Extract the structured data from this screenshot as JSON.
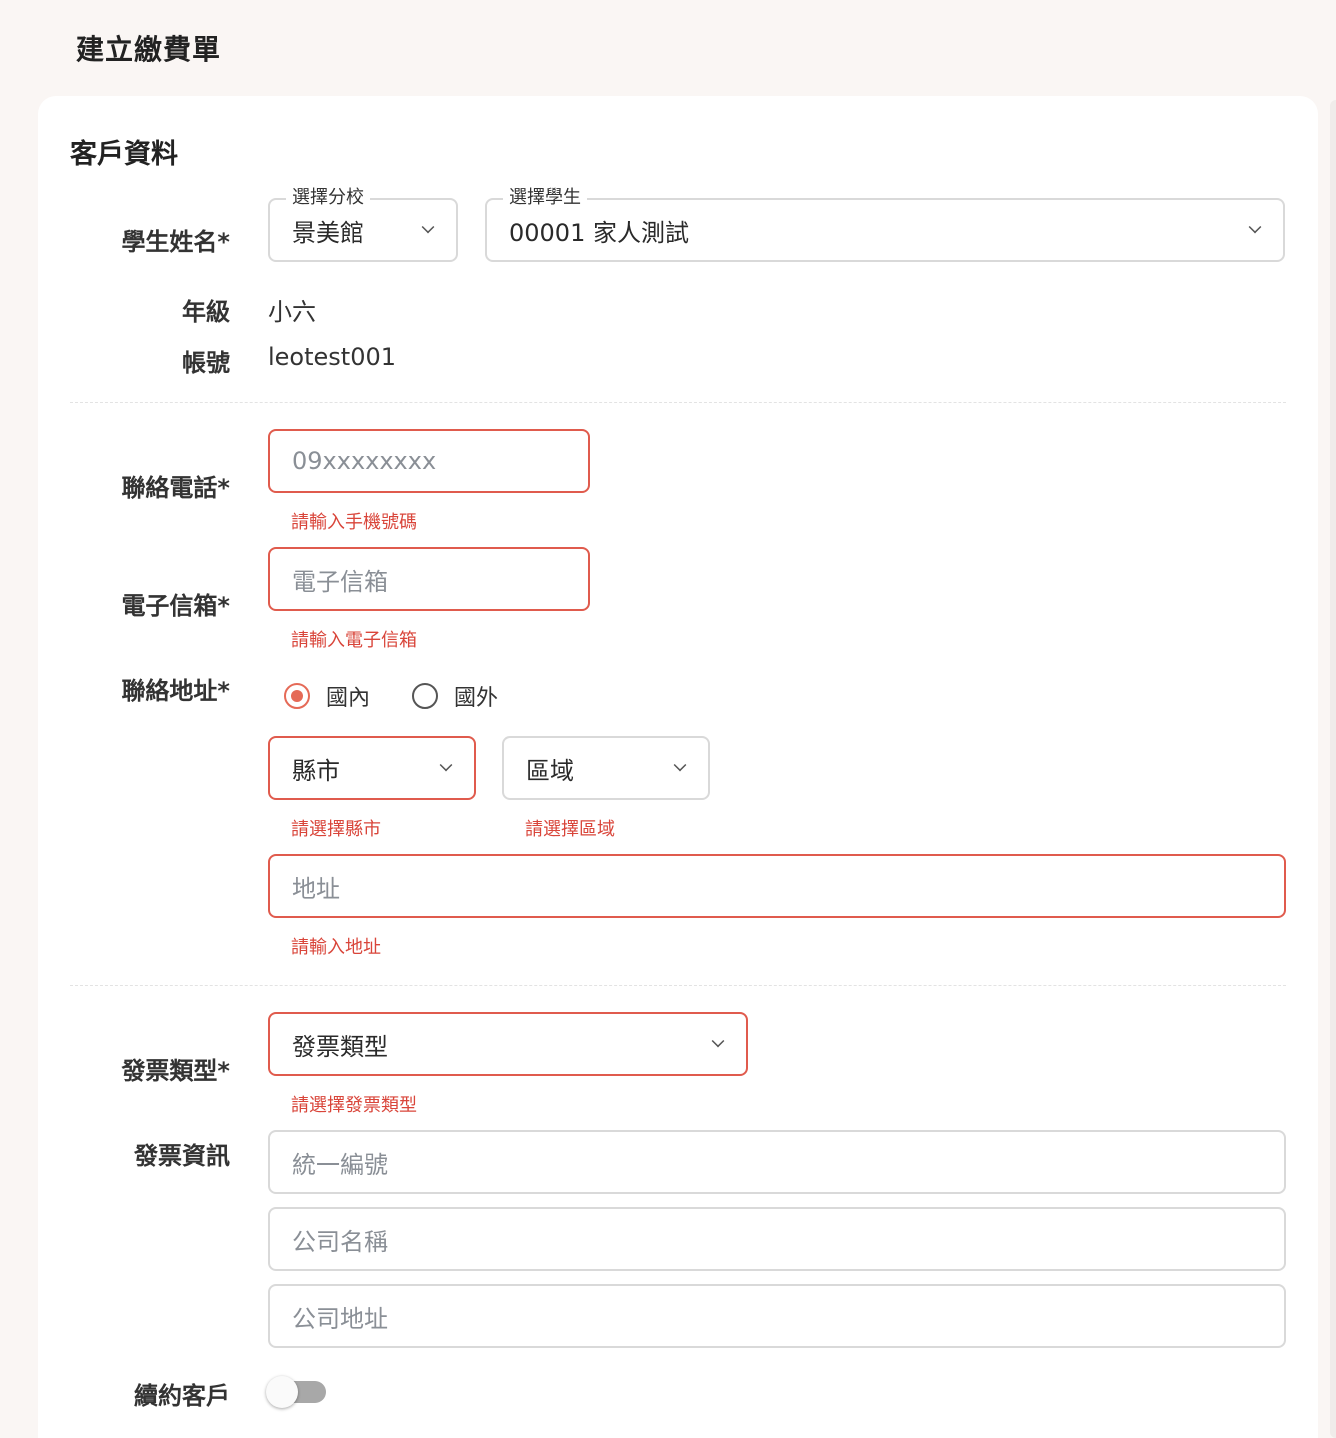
{
  "page": {
    "title": "建立繳費單"
  },
  "section": {
    "title": "客戶資料"
  },
  "student": {
    "label": "學生姓名*",
    "school_legend": "選擇分校",
    "school_value": "景美館",
    "student_legend": "選擇學生",
    "student_value": "00001 家人測試",
    "grade_label": "年級",
    "grade_value": "小六",
    "account_label": "帳號",
    "account_value": "leotest001"
  },
  "phone": {
    "label": "聯絡電話*",
    "placeholder": "09xxxxxxxx",
    "error": "請輸入手機號碼"
  },
  "email": {
    "label": "電子信箱*",
    "placeholder": "電子信箱",
    "error": "請輸入電子信箱"
  },
  "address": {
    "label": "聯絡地址*",
    "radio_domestic": "國內",
    "radio_foreign": "國外",
    "selected": "國內",
    "city_placeholder": "縣市",
    "city_error": "請選擇縣市",
    "district_placeholder": "區域",
    "district_error": "請選擇區域",
    "street_placeholder": "地址",
    "street_error": "請輸入地址"
  },
  "invoice": {
    "type_label": "發票類型*",
    "type_placeholder": "發票類型",
    "type_error": "請選擇發票類型",
    "info_label": "發票資訊",
    "tax_id_placeholder": "統一編號",
    "company_name_placeholder": "公司名稱",
    "company_address_placeholder": "公司地址"
  },
  "renewal": {
    "label": "續約客戶",
    "enabled": false
  },
  "colors": {
    "background": "#faf6f4",
    "card": "#ffffff",
    "error": "#d9453a",
    "error_border": "#e05b4d",
    "accent": "#e56a57"
  }
}
